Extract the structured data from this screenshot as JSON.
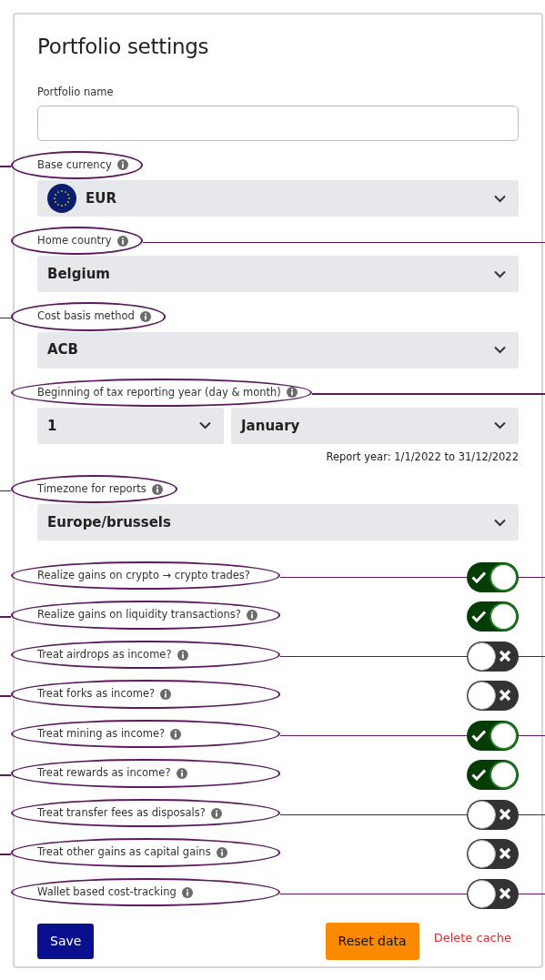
{
  "title": "Portfolio settings",
  "fields": [
    {
      "kind": "text",
      "label": "Portfolio name",
      "info": false
    },
    {
      "kind": "currency",
      "label": "Base currency",
      "info": true,
      "circled": true,
      "leader_right": false,
      "value": "EUR"
    },
    {
      "kind": "select",
      "label": "Home country",
      "info": true,
      "circled": true,
      "leader_right": true,
      "value": "Belgium"
    },
    {
      "kind": "select",
      "label": "Cost basis method",
      "info": true,
      "circled": true,
      "leader_right": false,
      "value": "ACB"
    },
    {
      "kind": "date",
      "label": "Beginning of tax reporting year (day & month)",
      "info": true,
      "circled": true,
      "leader_right": true,
      "day": "1",
      "month": "January",
      "note": "Report year: 1/1/2022 to 31/12/2022"
    },
    {
      "kind": "select",
      "label": "Timezone for reports",
      "info": true,
      "circled": true,
      "leader_right": false,
      "value": "Europe/brussels"
    }
  ],
  "toggles": [
    {
      "label": "Realize gains on crypto → crypto trades?",
      "info": false,
      "checked": true,
      "circled": true,
      "leader_right": true
    },
    {
      "label": "Realize gains on liquidity transactions?",
      "info": true,
      "checked": true,
      "circled": true,
      "leader_right": false
    },
    {
      "label": "Treat airdrops as income?",
      "info": true,
      "checked": false,
      "circled": true,
      "leader_right": true
    },
    {
      "label": "Treat forks as income?",
      "info": true,
      "checked": false,
      "circled": true,
      "leader_right": false
    },
    {
      "label": "Treat mining as income?",
      "info": true,
      "checked": true,
      "circled": true,
      "leader_right": true
    },
    {
      "label": "Treat rewards as income?",
      "info": true,
      "checked": true,
      "circled": true,
      "leader_right": false
    },
    {
      "label": "Treat transfer fees as disposals?",
      "info": true,
      "checked": false,
      "circled": true,
      "leader_right": true
    },
    {
      "label": "Treat other gains as capital gains",
      "info": true,
      "checked": false,
      "circled": true,
      "leader_right": false
    },
    {
      "label": "Wallet based cost-tracking",
      "info": true,
      "checked": false,
      "circled": true,
      "leader_right": true
    }
  ],
  "buttons": {
    "save": "Save",
    "reset": "Reset data",
    "delete": "Delete cache"
  }
}
